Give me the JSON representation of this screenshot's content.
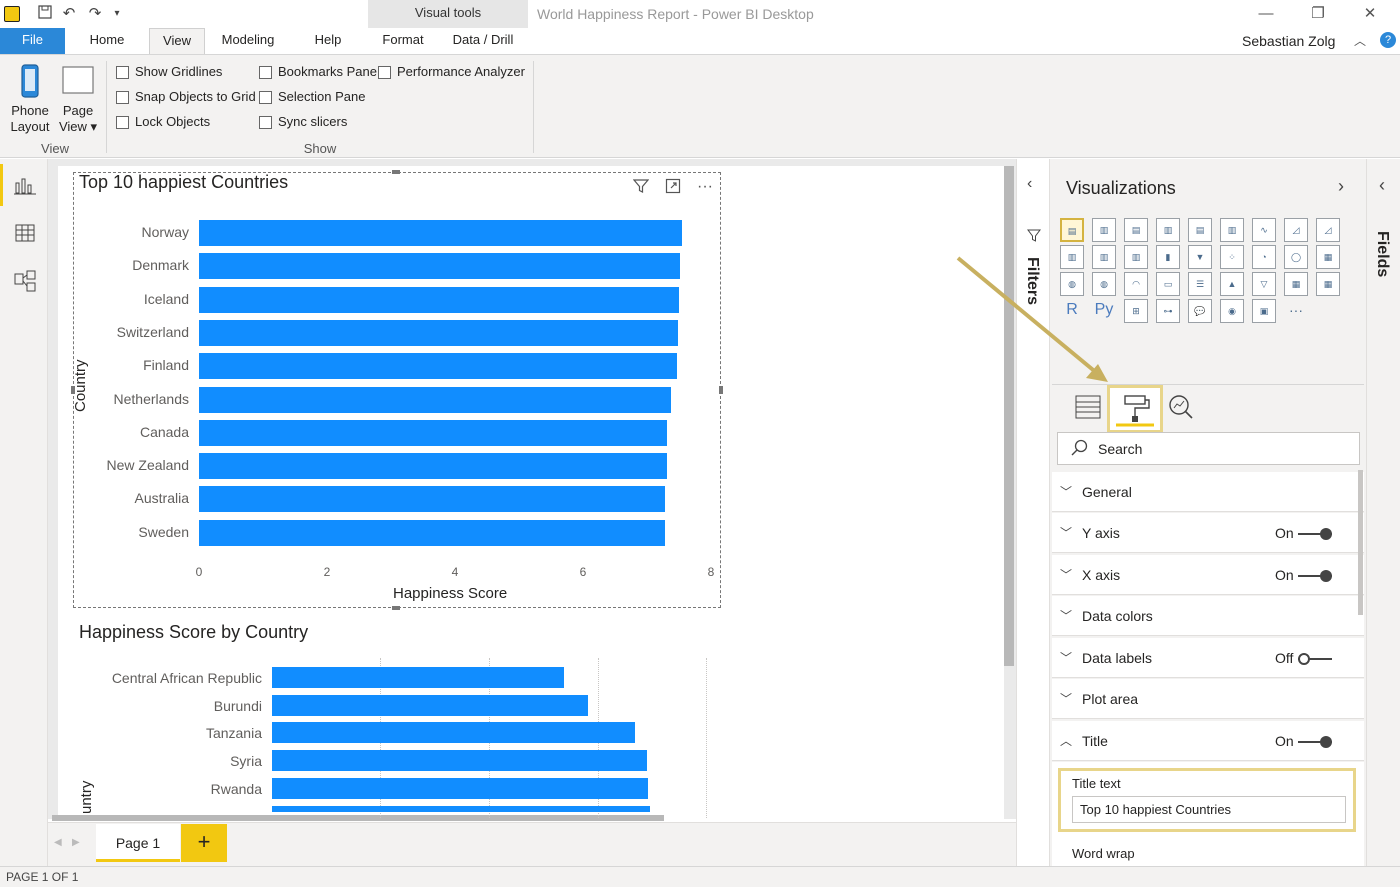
{
  "titlebar": {
    "context_group": "Visual tools",
    "document_title": "World Happiness Report - Power BI Desktop",
    "user": "Sebastian Zolg"
  },
  "tabs": [
    "File",
    "Home",
    "View",
    "Modeling",
    "Help",
    "Format",
    "Data / Drill"
  ],
  "ribbon": {
    "phone_layout": [
      "Phone",
      "Layout"
    ],
    "page_view": [
      "Page",
      "View ▾"
    ],
    "view_group_label": "View",
    "show_group_label": "Show",
    "checkboxes_col1": [
      "Show Gridlines",
      "Snap Objects to Grid",
      "Lock Objects"
    ],
    "checkboxes_col2": [
      "Bookmarks Pane",
      "Selection Pane",
      "Sync slicers"
    ],
    "checkboxes_col3": [
      "Performance Analyzer"
    ]
  },
  "chart1": {
    "title": "Top 10 happiest Countries",
    "xlabel": "Happiness Score",
    "ylabel": "Country"
  },
  "chart2": {
    "title": "Happiness Score by Country",
    "ylabel": "untry"
  },
  "chart_data": [
    {
      "type": "bar",
      "orientation": "horizontal",
      "title": "Top 10 happiest Countries",
      "xlabel": "Happiness Score",
      "ylabel": "Country",
      "categories": [
        "Norway",
        "Denmark",
        "Iceland",
        "Switzerland",
        "Finland",
        "Netherlands",
        "Canada",
        "New Zealand",
        "Australia",
        "Sweden"
      ],
      "values": [
        7.54,
        7.52,
        7.5,
        7.49,
        7.47,
        7.38,
        7.32,
        7.31,
        7.28,
        7.28
      ],
      "xlim": [
        0,
        8
      ],
      "xticks": [
        "0",
        "2",
        "4",
        "6",
        "8"
      ],
      "color": "#118dff",
      "grid": false
    },
    {
      "type": "bar",
      "orientation": "horizontal",
      "title": "Happiness Score by Country",
      "ylabel": "untry",
      "categories": [
        "Central African Republic",
        "Burundi",
        "Tanzania",
        "Syria",
        "Rwanda"
      ],
      "values": [
        2.69,
        2.91,
        3.35,
        3.46,
        3.47
      ],
      "xlim": [
        0,
        4.0
      ],
      "color": "#118dff",
      "grid": true
    }
  ],
  "pages": {
    "tab": "Page 1",
    "add": "+",
    "status": "PAGE 1 OF 1"
  },
  "filters_label": "Filters",
  "fields_label": "Fields",
  "viz_pane": {
    "title": "Visualizations",
    "search_placeholder": "Search",
    "visual_types": [
      "stacked-bar",
      "stacked-column",
      "clustered-bar",
      "clustered-column",
      "100-bar",
      "100-column",
      "line",
      "area",
      "stacked-area",
      "line-column",
      "line-clustered-column",
      "ribbon",
      "waterfall",
      "funnel",
      "scatter",
      "pie",
      "donut",
      "treemap",
      "map",
      "filled-map",
      "gauge",
      "card",
      "multi-row-card",
      "kpi",
      "slicer",
      "table",
      "matrix",
      "r-visual",
      "python-visual",
      "key-influencers",
      "decomposition-tree",
      "qa",
      "arcgis",
      "custom-visual",
      "more"
    ],
    "sections": [
      {
        "label": "General",
        "chevron": "down",
        "state": ""
      },
      {
        "label": "Y axis",
        "chevron": "down",
        "state": "On"
      },
      {
        "label": "X axis",
        "chevron": "down",
        "state": "On"
      },
      {
        "label": "Data colors",
        "chevron": "down",
        "state": ""
      },
      {
        "label": "Data labels",
        "chevron": "down",
        "state": "Off"
      },
      {
        "label": "Plot area",
        "chevron": "down",
        "state": ""
      },
      {
        "label": "Title",
        "chevron": "up",
        "state": "On"
      }
    ],
    "title_text_label": "Title text",
    "title_text_value": "Top 10 happiest Countries",
    "word_wrap_label": "Word wrap"
  },
  "colors": {
    "accent_yellow": "#f2c811",
    "highlight": "#d4b341",
    "bar_blue": "#118dff",
    "file_tab": "#2b88d8"
  }
}
